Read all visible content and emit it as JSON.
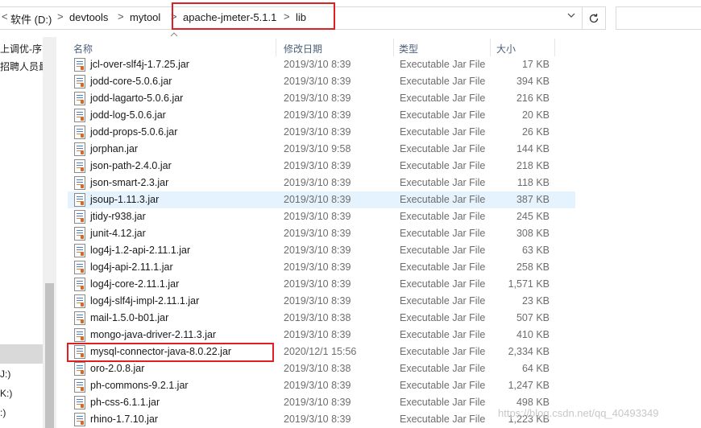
{
  "address_bar": {
    "chevron": "<",
    "crumbs": [
      "软件 (D:)",
      "devtools",
      "mytool",
      "apache-jmeter-5.1.1",
      "lib"
    ],
    "separator": ">",
    "dropdown_icon": "chevron-down-icon",
    "refresh_icon": "refresh-icon"
  },
  "nav_pane": {
    "items": [
      "上调优-序言",
      "招聘人员最",
      "J:)",
      "K:)",
      ":)"
    ]
  },
  "columns": {
    "name": "名称",
    "date": "修改日期",
    "type": "类型",
    "size": "大小"
  },
  "files": [
    {
      "name": "jcl-over-slf4j-1.7.25.jar",
      "date": "2019/3/10 8:39",
      "type": "Executable Jar File",
      "size": "17 KB"
    },
    {
      "name": "jodd-core-5.0.6.jar",
      "date": "2019/3/10 8:39",
      "type": "Executable Jar File",
      "size": "394 KB"
    },
    {
      "name": "jodd-lagarto-5.0.6.jar",
      "date": "2019/3/10 8:39",
      "type": "Executable Jar File",
      "size": "216 KB"
    },
    {
      "name": "jodd-log-5.0.6.jar",
      "date": "2019/3/10 8:39",
      "type": "Executable Jar File",
      "size": "20 KB"
    },
    {
      "name": "jodd-props-5.0.6.jar",
      "date": "2019/3/10 8:39",
      "type": "Executable Jar File",
      "size": "26 KB"
    },
    {
      "name": "jorphan.jar",
      "date": "2019/3/10 9:58",
      "type": "Executable Jar File",
      "size": "144 KB"
    },
    {
      "name": "json-path-2.4.0.jar",
      "date": "2019/3/10 8:39",
      "type": "Executable Jar File",
      "size": "218 KB"
    },
    {
      "name": "json-smart-2.3.jar",
      "date": "2019/3/10 8:39",
      "type": "Executable Jar File",
      "size": "118 KB"
    },
    {
      "name": "jsoup-1.11.3.jar",
      "date": "2019/3/10 8:39",
      "type": "Executable Jar File",
      "size": "387 KB"
    },
    {
      "name": "jtidy-r938.jar",
      "date": "2019/3/10 8:39",
      "type": "Executable Jar File",
      "size": "245 KB"
    },
    {
      "name": "junit-4.12.jar",
      "date": "2019/3/10 8:39",
      "type": "Executable Jar File",
      "size": "308 KB"
    },
    {
      "name": "log4j-1.2-api-2.11.1.jar",
      "date": "2019/3/10 8:39",
      "type": "Executable Jar File",
      "size": "63 KB"
    },
    {
      "name": "log4j-api-2.11.1.jar",
      "date": "2019/3/10 8:39",
      "type": "Executable Jar File",
      "size": "258 KB"
    },
    {
      "name": "log4j-core-2.11.1.jar",
      "date": "2019/3/10 8:39",
      "type": "Executable Jar File",
      "size": "1,571 KB"
    },
    {
      "name": "log4j-slf4j-impl-2.11.1.jar",
      "date": "2019/3/10 8:39",
      "type": "Executable Jar File",
      "size": "23 KB"
    },
    {
      "name": "mail-1.5.0-b01.jar",
      "date": "2019/3/10 8:38",
      "type": "Executable Jar File",
      "size": "507 KB"
    },
    {
      "name": "mongo-java-driver-2.11.3.jar",
      "date": "2019/3/10 8:39",
      "type": "Executable Jar File",
      "size": "410 KB"
    },
    {
      "name": "mysql-connector-java-8.0.22.jar",
      "date": "2020/12/1 15:56",
      "type": "Executable Jar File",
      "size": "2,334 KB"
    },
    {
      "name": "oro-2.0.8.jar",
      "date": "2019/3/10 8:38",
      "type": "Executable Jar File",
      "size": "64 KB"
    },
    {
      "name": "ph-commons-9.2.1.jar",
      "date": "2019/3/10 8:39",
      "type": "Executable Jar File",
      "size": "1,247 KB"
    },
    {
      "name": "ph-css-6.1.1.jar",
      "date": "2019/3/10 8:39",
      "type": "Executable Jar File",
      "size": "498 KB"
    },
    {
      "name": "rhino-1.7.10.jar",
      "date": "2019/3/10 8:39",
      "type": "Executable Jar File",
      "size": "1,223 KB"
    }
  ],
  "hovered_file": "jsoup-1.11.3.jar",
  "watermark": "https://blog.csdn.net/qq_40493349",
  "colors": {
    "highlight_box": "#e02020",
    "hover_row": "#e5f3ff",
    "header_text": "#4c607a"
  }
}
